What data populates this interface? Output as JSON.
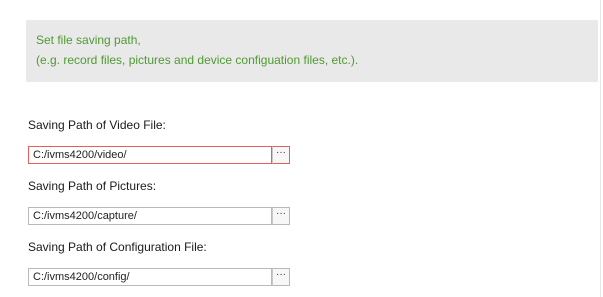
{
  "info": {
    "line1": "Set file saving path,",
    "line2": "(e.g. record files, pictures and device configuation files, etc.)."
  },
  "fields": {
    "video": {
      "label": "Saving Path of Video File:",
      "value": "C:/ivms4200/video/",
      "button_label": "···",
      "focused": true
    },
    "pictures": {
      "label": "Saving Path of Pictures:",
      "value": "C:/ivms4200/capture/",
      "button_label": "···"
    },
    "config": {
      "label": "Saving Path of Configuration File:",
      "value": "C:/ivms4200/config/",
      "button_label": "···"
    }
  },
  "colors": {
    "info_text": "#4f9a33",
    "info_background": "#e9e9e9",
    "focus_border": "#e0605c"
  }
}
